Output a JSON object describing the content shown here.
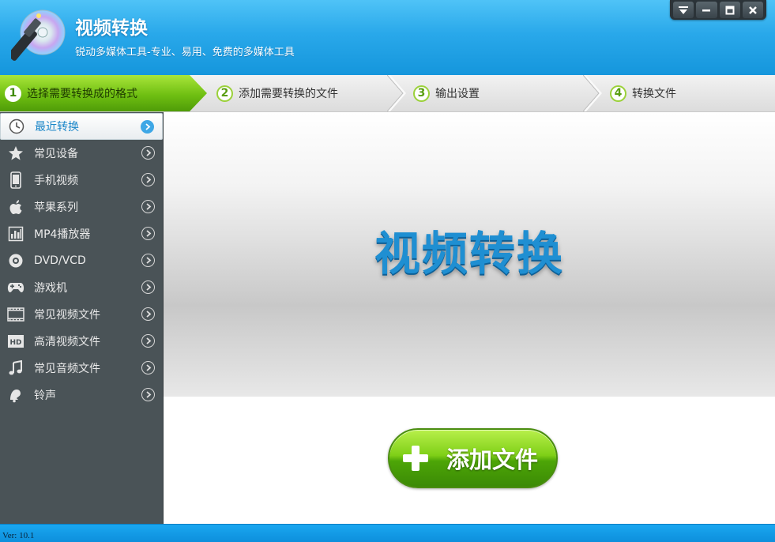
{
  "app": {
    "title": "视频转换",
    "subtitle": "锐动多媒体工具-专业、易用、免费的多媒体工具"
  },
  "window_controls": [
    "menu-icon",
    "minimize-icon",
    "maximize-icon",
    "close-icon"
  ],
  "steps": [
    {
      "num": "1",
      "label": "选择需要转换成的格式",
      "active": true
    },
    {
      "num": "2",
      "label": "添加需要转换的文件",
      "active": false
    },
    {
      "num": "3",
      "label": "输出设置",
      "active": false
    },
    {
      "num": "4",
      "label": "转换文件",
      "active": false
    }
  ],
  "sidebar": {
    "items": [
      {
        "label": "最近转换",
        "icon": "clock-icon",
        "active": true
      },
      {
        "label": "常见设备",
        "icon": "star-icon"
      },
      {
        "label": "手机视频",
        "icon": "phone-icon"
      },
      {
        "label": "苹果系列",
        "icon": "apple-icon"
      },
      {
        "label": "MP4播放器",
        "icon": "mp4-player-icon"
      },
      {
        "label": "DVD/VCD",
        "icon": "disc-icon"
      },
      {
        "label": "游戏机",
        "icon": "gamepad-icon"
      },
      {
        "label": "常见视频文件",
        "icon": "film-icon"
      },
      {
        "label": "高清视频文件",
        "icon": "hd-icon"
      },
      {
        "label": "常见音频文件",
        "icon": "music-note-icon"
      },
      {
        "label": "铃声",
        "icon": "ringtone-icon"
      }
    ]
  },
  "main": {
    "hero_title": "视频转换",
    "add_button_label": "添加文件"
  },
  "status": {
    "version": "Ver: 10.1"
  },
  "colors": {
    "header_blue": "#29a8ea",
    "accent_green": "#7fcf17",
    "sidebar_bg": "#4a5357",
    "hero_text": "#1f8fd2"
  }
}
